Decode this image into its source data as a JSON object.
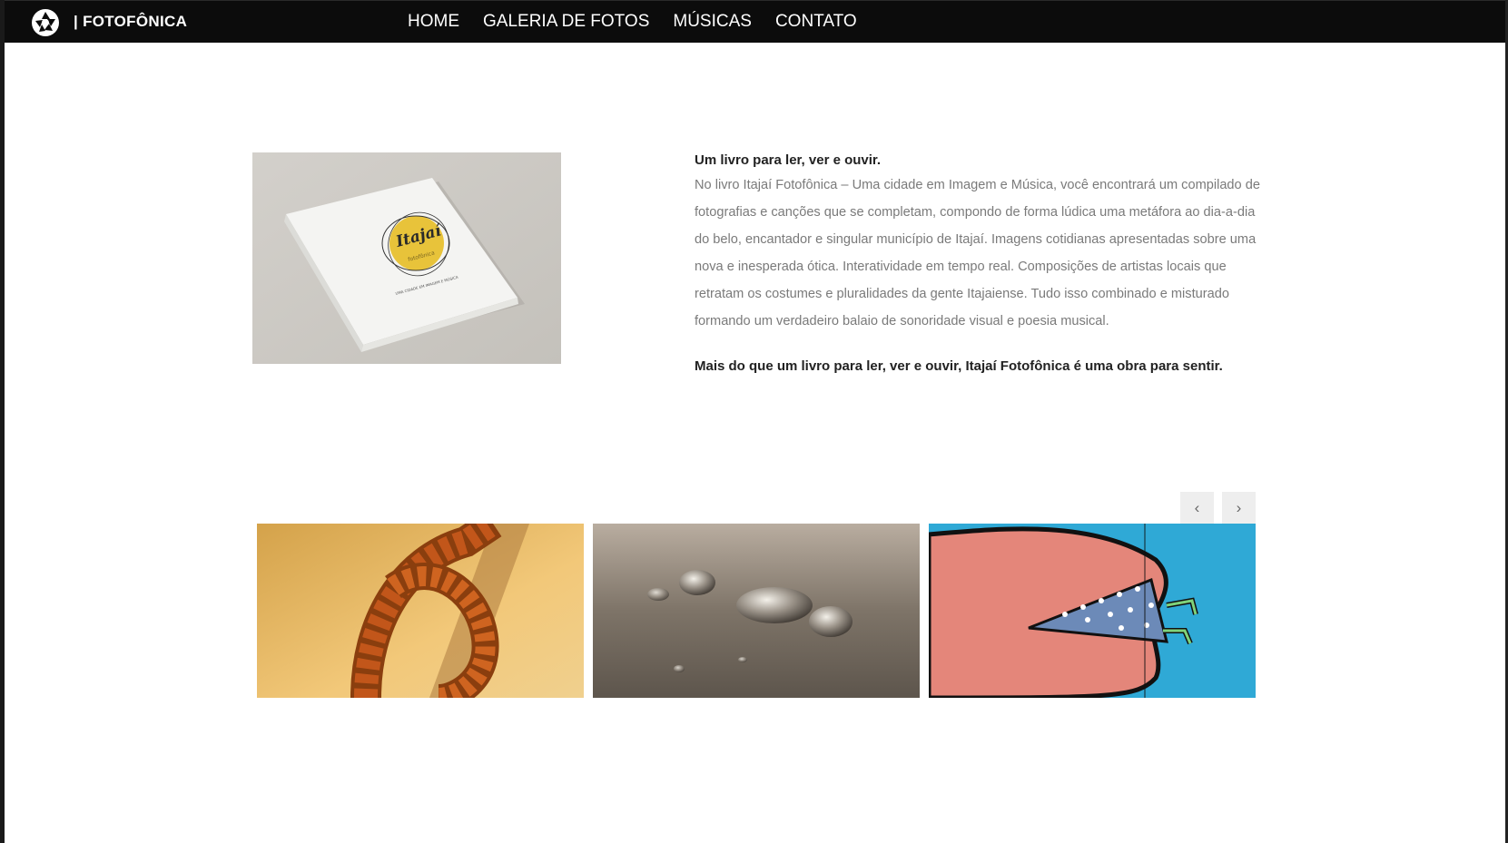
{
  "navbar": {
    "brand": "| FOTOFÔNICA",
    "logo_icon": "camera-aperture-icon",
    "items": [
      {
        "label": "HOME"
      },
      {
        "label": "GALERIA DE FOTOS"
      },
      {
        "label": "MÚSICAS"
      },
      {
        "label": "CONTATO"
      }
    ]
  },
  "intro": {
    "title": "Um livro para ler, ver e ouvir.",
    "body": "No livro Itajaí Fotofônica – Uma cidade em Imagem e Música, você encontrará um compilado de fotografias e canções que se completam, compondo de forma lúdica uma metáfora ao dia-a-dia do belo, encantador e singular município de Itajaí. Imagens cotidianas apresentadas sobre uma nova e inesperada ótica. Interatividade em tempo real. Composições de artistas locais que retratam os costumes e pluralidades da gente Itajaiense. Tudo isso combinado e misturado formando um verdadeiro balaio de sonoridade visual e poesia musical.",
    "closing": "Mais do que um livro para ler, ver e ouvir, Itajaí Fotofônica é uma obra para sentir."
  },
  "book_cover": {
    "title": "Itajaí",
    "subtitle": "fotofônica",
    "tagline": "UMA CIDADE EM IMAGEM E MÚSICA"
  },
  "carousel": {
    "prev_label": "‹",
    "next_label": "›"
  },
  "colors": {
    "navbar_bg": "#0c0c0c",
    "accent_yellow": "#e8c33a",
    "text_dark": "#222222",
    "text_muted": "#7a7a7a"
  }
}
